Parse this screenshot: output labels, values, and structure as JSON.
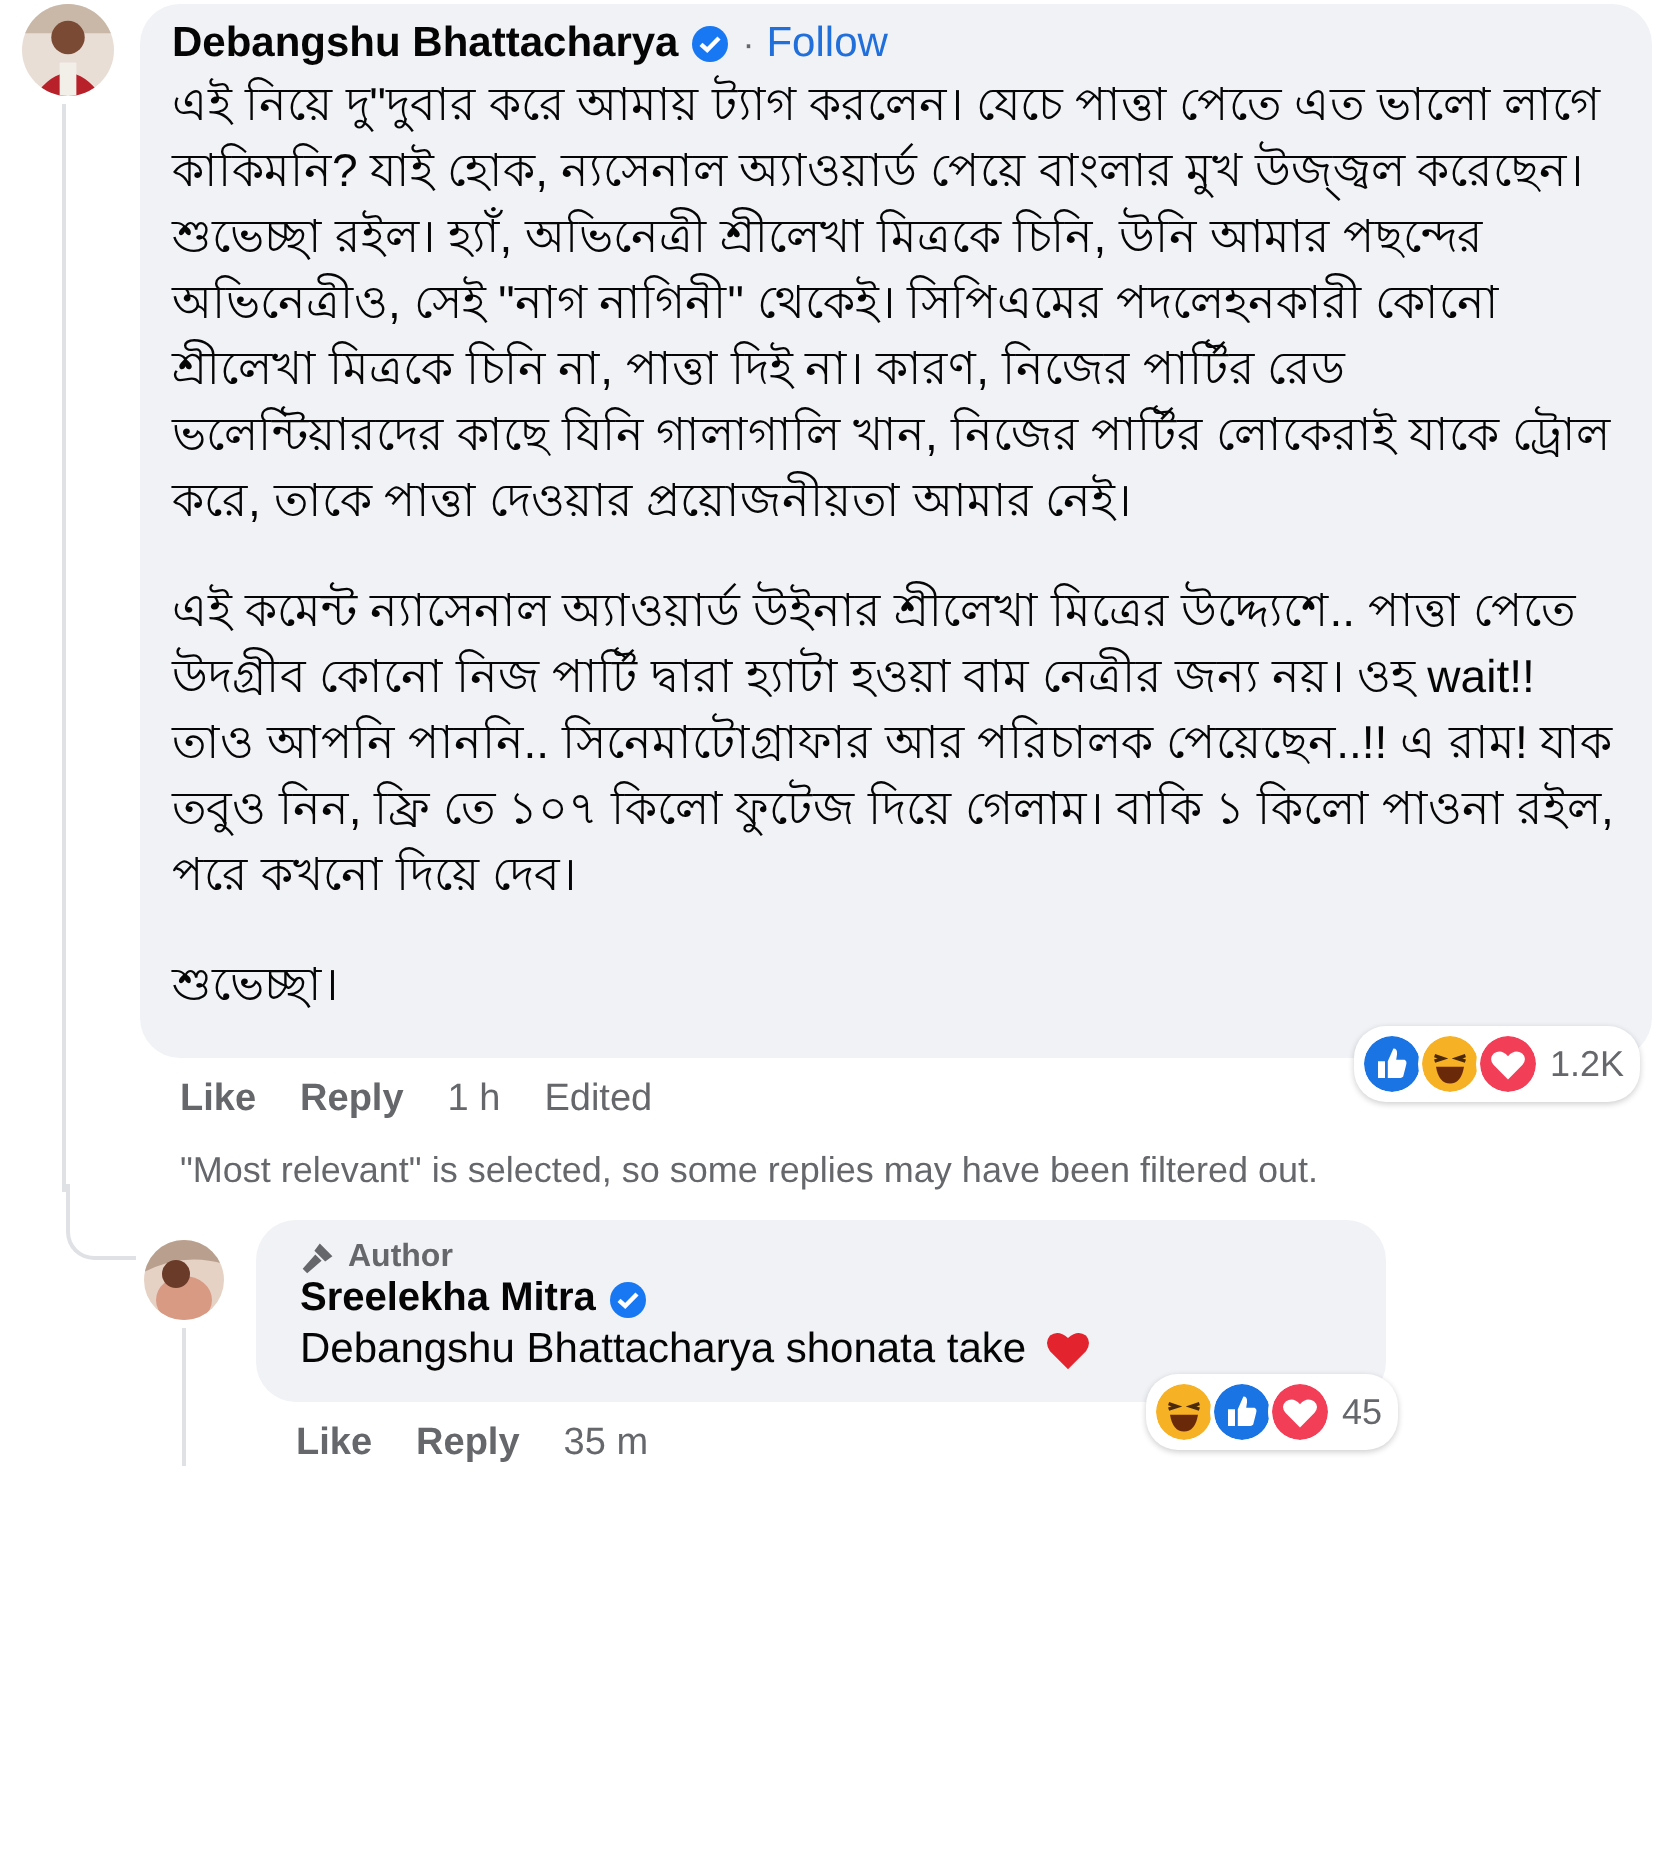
{
  "comment": {
    "author": "Debangshu Bhattacharya",
    "verified": true,
    "separator": "·",
    "follow": "Follow",
    "paragraphs": [
      "এই নিয়ে দু\"দুবার করে আমায় ট্যাগ করলেন। যেচে পাত্তা পেতে এত ভালো লাগে কাকিমনি? যাই হোক, ন্যসেনাল অ্যাওয়ার্ড পেয়ে বাংলার মুখ উজ্জ্বল করেছেন। শুভেচ্ছা রইল। হ্যাঁ, অভিনেত্রী শ্রীলেখা মিত্রকে চিনি, উনি আমার পছন্দের অভিনেত্রীও, সেই \"নাগ নাগিনী\" থেকেই। সিপিএমের পদলেহনকারী কোনো শ্রীলেখা মিত্রকে চিনি না, পাত্তা দিই না। কারণ, নিজের পার্টির রেড ভলেন্টিয়ারদের কাছে যিনি গালাগালি খান, নিজের পার্টির লোকেরাই যাকে ট্রোল করে, তাকে পাত্তা দেওয়ার প্রয়োজনীয়তা আমার নেই।",
      "এই কমেন্ট ন্যাসেনাল অ্যাওয়ার্ড উইনার শ্রীলেখা মিত্রের উদ্দ্যেশে.. পাত্তা পেতে উদগ্রীব কোনো নিজ পার্টি দ্বারা হ্যাটা হওয়া বাম নেত্রীর জন্য নয়। ওহ wait!! তাও আপনি পাননি.. সিনেমাটোগ্রাফার আর পরিচালক পেয়েছেন..!! এ রাম! যাক তবুও নিন, ফ্রি তে ১০৭ কিলো ফুটেজ দিয়ে গেলাম। বাকি ১ কিলো পাওনা রইল, পরে কখনো দিয়ে দেব।",
      "শুভেচ্ছা।"
    ],
    "reactions": [
      {
        "kind": "like"
      },
      {
        "kind": "haha"
      },
      {
        "kind": "love"
      }
    ],
    "reaction_count": "1.2K",
    "actions": [
      "Like",
      "Reply"
    ],
    "time": "1 h",
    "edited": "Edited"
  },
  "filter_notice": "\"Most relevant\" is selected, so some replies may have been filtered out.",
  "reply": {
    "badge": "Author",
    "author": "Sreelekha Mitra",
    "verified": true,
    "text": "Debangshu Bhattacharya shonata take",
    "heart": true,
    "reactions": [
      {
        "kind": "haha"
      },
      {
        "kind": "like"
      },
      {
        "kind": "love"
      }
    ],
    "reaction_count": "45",
    "actions": [
      "Like",
      "Reply"
    ],
    "time": "35 m"
  }
}
